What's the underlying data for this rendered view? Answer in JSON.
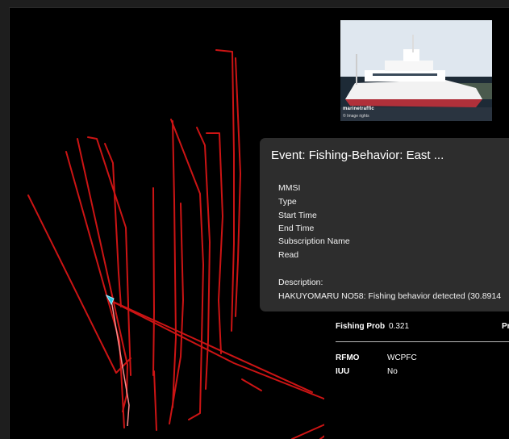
{
  "photo": {
    "watermark": "marinetraffic",
    "credit": "© Image rights"
  },
  "popup": {
    "title": "Event: Fishing-Behavior: East ...",
    "fields": {
      "mmsi": "MMSI",
      "type": "Type",
      "start_time": "Start Time",
      "end_time": "End Time",
      "subscription_name": "Subscription Name",
      "read": "Read"
    },
    "description_label": "Description:",
    "description_value": "HAKUYOMARU NO58: Fishing behavior detected (30.8914"
  },
  "vessel_details": {
    "fishing_prob_label": "Fishing Prob",
    "fishing_prob_value": "0.321",
    "trailing_label": "Pres",
    "rfmo_label": "RFMO",
    "rfmo_value": "WCPFC",
    "iuu_label": "IUU",
    "iuu_value": "No"
  },
  "colors": {
    "track": "#cc1414",
    "vessel_marker": "#27c4e0",
    "popup_bg": "#2d2d2d",
    "map_bg": "#000000"
  }
}
